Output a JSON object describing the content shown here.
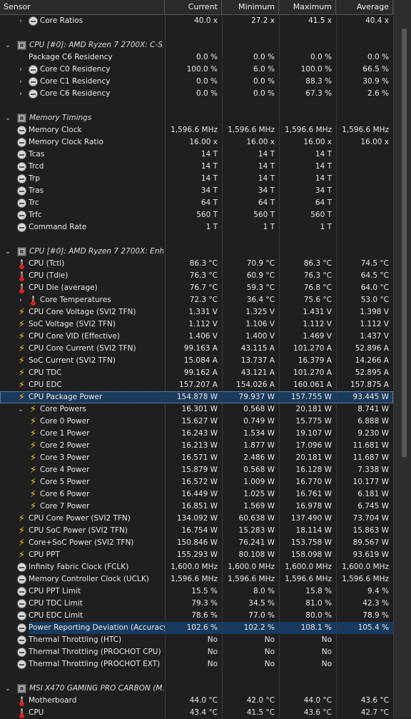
{
  "header": {
    "sensor": "Sensor",
    "current": "Current",
    "minimum": "Minimum",
    "maximum": "Maximum",
    "average": "Average"
  },
  "rows": [
    {
      "type": "sensor",
      "indent": 1,
      "chev": "›",
      "icon": "clock",
      "label": "Core Ratios",
      "cur": "40.0 x",
      "min": "27.2 x",
      "max": "41.5 x",
      "avg": "40.4 x"
    },
    {
      "type": "blank"
    },
    {
      "type": "group",
      "label": "CPU [#0]: AMD Ryzen 7 2700X: C-S..."
    },
    {
      "type": "sensor",
      "indent": 0,
      "icon": "none",
      "label": "Package C6 Residency",
      "cur": "0.0 %",
      "min": "0.0 %",
      "max": "0.0 %",
      "avg": "0.0 %"
    },
    {
      "type": "sensor",
      "indent": 1,
      "chev": "›",
      "icon": "clock",
      "label": "Core C0 Residency",
      "cur": "100.0 %",
      "min": "6.0 %",
      "max": "100.0 %",
      "avg": "66.5 %"
    },
    {
      "type": "sensor",
      "indent": 1,
      "chev": "›",
      "icon": "clock",
      "label": "Core C1 Residency",
      "cur": "0.0 %",
      "min": "0.0 %",
      "max": "88.3 %",
      "avg": "30.9 %"
    },
    {
      "type": "sensor",
      "indent": 1,
      "chev": "›",
      "icon": "clock",
      "label": "Core C6 Residency",
      "cur": "0.0 %",
      "min": "0.0 %",
      "max": "67.3 %",
      "avg": "2.6 %"
    },
    {
      "type": "blank"
    },
    {
      "type": "group",
      "label": "Memory Timings"
    },
    {
      "type": "sensor",
      "indent": 0,
      "icon": "clock",
      "label": "Memory Clock",
      "cur": "1,596.6 MHz",
      "min": "1,596.6 MHz",
      "max": "1,596.6 MHz",
      "avg": "1,596.6 MHz"
    },
    {
      "type": "sensor",
      "indent": 0,
      "icon": "clock",
      "label": "Memory Clock Ratio",
      "cur": "16.00 x",
      "min": "16.00 x",
      "max": "16.00 x",
      "avg": "16.00 x"
    },
    {
      "type": "sensor",
      "indent": 0,
      "icon": "clock",
      "label": "Tcas",
      "cur": "14 T",
      "min": "14 T",
      "max": "14 T",
      "avg": ""
    },
    {
      "type": "sensor",
      "indent": 0,
      "icon": "clock",
      "label": "Trcd",
      "cur": "14 T",
      "min": "14 T",
      "max": "14 T",
      "avg": ""
    },
    {
      "type": "sensor",
      "indent": 0,
      "icon": "clock",
      "label": "Trp",
      "cur": "14 T",
      "min": "14 T",
      "max": "14 T",
      "avg": ""
    },
    {
      "type": "sensor",
      "indent": 0,
      "icon": "clock",
      "label": "Tras",
      "cur": "34 T",
      "min": "34 T",
      "max": "34 T",
      "avg": ""
    },
    {
      "type": "sensor",
      "indent": 0,
      "icon": "clock",
      "label": "Trc",
      "cur": "64 T",
      "min": "64 T",
      "max": "64 T",
      "avg": ""
    },
    {
      "type": "sensor",
      "indent": 0,
      "icon": "clock",
      "label": "Trfc",
      "cur": "560 T",
      "min": "560 T",
      "max": "560 T",
      "avg": ""
    },
    {
      "type": "sensor",
      "indent": 0,
      "icon": "clock",
      "label": "Command Rate",
      "cur": "1 T",
      "min": "1 T",
      "max": "1 T",
      "avg": ""
    },
    {
      "type": "blank"
    },
    {
      "type": "group",
      "label": "CPU [#0]: AMD Ryzen 7 2700X: Enh..."
    },
    {
      "type": "sensor",
      "indent": 0,
      "icon": "therm",
      "label": "CPU (Tctl)",
      "cur": "86.3 °C",
      "min": "70.9 °C",
      "max": "86.3 °C",
      "avg": "74.5 °C"
    },
    {
      "type": "sensor",
      "indent": 0,
      "icon": "therm",
      "label": "CPU (Tdie)",
      "cur": "76.3 °C",
      "min": "60.9 °C",
      "max": "76.3 °C",
      "avg": "64.5 °C"
    },
    {
      "type": "sensor",
      "indent": 0,
      "icon": "therm",
      "label": "CPU Die (average)",
      "cur": "76.7 °C",
      "min": "59.3 °C",
      "max": "76.8 °C",
      "avg": "64.0 °C"
    },
    {
      "type": "sensor",
      "indent": 1,
      "chev": "›",
      "icon": "therm",
      "label": "Core Temperatures",
      "cur": "72.3 °C",
      "min": "36.4 °C",
      "max": "75.6 °C",
      "avg": "53.0 °C"
    },
    {
      "type": "sensor",
      "indent": 0,
      "icon": "bolt",
      "label": "CPU Core Voltage (SVI2 TFN)",
      "cur": "1.331 V",
      "min": "1.325 V",
      "max": "1.431 V",
      "avg": "1.398 V"
    },
    {
      "type": "sensor",
      "indent": 0,
      "icon": "bolt",
      "label": "SoC Voltage (SVI2 TFN)",
      "cur": "1.112 V",
      "min": "1.106 V",
      "max": "1.112 V",
      "avg": "1.112 V"
    },
    {
      "type": "sensor",
      "indent": 0,
      "icon": "bolt",
      "label": "CPU Core VID (Effective)",
      "cur": "1.406 V",
      "min": "1.400 V",
      "max": "1.469 V",
      "avg": "1.437 V"
    },
    {
      "type": "sensor",
      "indent": 0,
      "icon": "bolt",
      "label": "CPU Core Current (SVI2 TFN)",
      "cur": "99.163 A",
      "min": "43.115 A",
      "max": "101.270 A",
      "avg": "52.896 A"
    },
    {
      "type": "sensor",
      "indent": 0,
      "icon": "bolt",
      "label": "SoC Current (SVI2 TFN)",
      "cur": "15.084 A",
      "min": "13.737 A",
      "max": "16.379 A",
      "avg": "14.266 A"
    },
    {
      "type": "sensor",
      "indent": 0,
      "icon": "bolt",
      "label": "CPU TDC",
      "cur": "99.162 A",
      "min": "43.121 A",
      "max": "101.270 A",
      "avg": "52.895 A"
    },
    {
      "type": "sensor",
      "indent": 0,
      "icon": "bolt",
      "label": "CPU EDC",
      "cur": "157.207 A",
      "min": "154.026 A",
      "max": "160.061 A",
      "avg": "157.875 A"
    },
    {
      "type": "sensor",
      "indent": 0,
      "icon": "bolt",
      "label": "CPU Package Power",
      "cur": "154.878 W",
      "min": "79.937 W",
      "max": "157.755 W",
      "avg": "93.445 W",
      "selected": true
    },
    {
      "type": "sensor",
      "indent": 1,
      "chev": "⌄",
      "icon": "bolt",
      "label": "Core Powers",
      "cur": "16.301 W",
      "min": "0.568 W",
      "max": "20.181 W",
      "avg": "8.741 W"
    },
    {
      "type": "sensor",
      "indent": 1,
      "icon": "bolt",
      "label": "Core 0 Power",
      "cur": "15.627 W",
      "min": "0.749 W",
      "max": "15.775 W",
      "avg": "6.888 W"
    },
    {
      "type": "sensor",
      "indent": 1,
      "icon": "bolt",
      "label": "Core 1 Power",
      "cur": "16.243 W",
      "min": "1.534 W",
      "max": "19.107 W",
      "avg": "9.230 W"
    },
    {
      "type": "sensor",
      "indent": 1,
      "icon": "bolt",
      "label": "Core 2 Power",
      "cur": "16.213 W",
      "min": "1.877 W",
      "max": "17.096 W",
      "avg": "11.681 W"
    },
    {
      "type": "sensor",
      "indent": 1,
      "icon": "bolt",
      "label": "Core 3 Power",
      "cur": "16.571 W",
      "min": "2.486 W",
      "max": "20.181 W",
      "avg": "11.687 W"
    },
    {
      "type": "sensor",
      "indent": 1,
      "icon": "bolt",
      "label": "Core 4 Power",
      "cur": "15.879 W",
      "min": "0.568 W",
      "max": "16.128 W",
      "avg": "7.338 W"
    },
    {
      "type": "sensor",
      "indent": 1,
      "icon": "bolt",
      "label": "Core 5 Power",
      "cur": "16.572 W",
      "min": "1.009 W",
      "max": "16.770 W",
      "avg": "10.177 W"
    },
    {
      "type": "sensor",
      "indent": 1,
      "icon": "bolt",
      "label": "Core 6 Power",
      "cur": "16.449 W",
      "min": "1.025 W",
      "max": "16.761 W",
      "avg": "6.181 W"
    },
    {
      "type": "sensor",
      "indent": 1,
      "icon": "bolt",
      "label": "Core 7 Power",
      "cur": "16.851 W",
      "min": "1.569 W",
      "max": "16.978 W",
      "avg": "6.745 W"
    },
    {
      "type": "sensor",
      "indent": 0,
      "icon": "bolt",
      "label": "CPU Core Power (SVI2 TFN)",
      "cur": "134.092 W",
      "min": "60.638 W",
      "max": "137.490 W",
      "avg": "73.704 W"
    },
    {
      "type": "sensor",
      "indent": 0,
      "icon": "bolt",
      "label": "CPU SoC Power (SVI2 TFN)",
      "cur": "16.754 W",
      "min": "15.283 W",
      "max": "18.114 W",
      "avg": "15.863 W"
    },
    {
      "type": "sensor",
      "indent": 0,
      "icon": "bolt",
      "label": "Core+SoC Power (SVI2 TFN)",
      "cur": "150.846 W",
      "min": "76.241 W",
      "max": "153.758 W",
      "avg": "89.567 W"
    },
    {
      "type": "sensor",
      "indent": 0,
      "icon": "bolt",
      "label": "CPU PPT",
      "cur": "155.293 W",
      "min": "80.108 W",
      "max": "158.098 W",
      "avg": "93.619 W"
    },
    {
      "type": "sensor",
      "indent": 0,
      "icon": "clock",
      "label": "Infinity Fabric Clock (FCLK)",
      "cur": "1,600.0 MHz",
      "min": "1,600.0 MHz",
      "max": "1,600.0 MHz",
      "avg": "1,600.0 MHz"
    },
    {
      "type": "sensor",
      "indent": 0,
      "icon": "clock",
      "label": "Memory Controller Clock (UCLK)",
      "cur": "1,596.6 MHz",
      "min": "1,596.6 MHz",
      "max": "1,596.6 MHz",
      "avg": "1,596.6 MHz"
    },
    {
      "type": "sensor",
      "indent": 0,
      "icon": "clock",
      "label": "CPU PPT Limit",
      "cur": "15.5 %",
      "min": "8.0 %",
      "max": "15.8 %",
      "avg": "9.4 %"
    },
    {
      "type": "sensor",
      "indent": 0,
      "icon": "clock",
      "label": "CPU TDC Limit",
      "cur": "79.3 %",
      "min": "34.5 %",
      "max": "81.0 %",
      "avg": "42.3 %"
    },
    {
      "type": "sensor",
      "indent": 0,
      "icon": "clock",
      "label": "CPU EDC Limit",
      "cur": "78.6 %",
      "min": "77.0 %",
      "max": "80.0 %",
      "avg": "78.9 %"
    },
    {
      "type": "sensor",
      "indent": 0,
      "icon": "clock",
      "label": "Power Reporting Deviation (Accuracy)",
      "cur": "102.6 %",
      "min": "102.2 %",
      "max": "108.1 %",
      "avg": "105.4 %",
      "highlight": true
    },
    {
      "type": "sensor",
      "indent": 0,
      "icon": "clock",
      "label": "Thermal Throttling (HTC)",
      "cur": "No",
      "min": "No",
      "max": "No",
      "avg": ""
    },
    {
      "type": "sensor",
      "indent": 0,
      "icon": "clock",
      "label": "Thermal Throttling (PROCHOT CPU)",
      "cur": "No",
      "min": "No",
      "max": "No",
      "avg": ""
    },
    {
      "type": "sensor",
      "indent": 0,
      "icon": "clock",
      "label": "Thermal Throttling (PROCHOT EXT)",
      "cur": "No",
      "min": "No",
      "max": "No",
      "avg": ""
    },
    {
      "type": "blank"
    },
    {
      "type": "group",
      "label": "MSI X470 GAMING PRO CARBON (M..."
    },
    {
      "type": "sensor",
      "indent": 0,
      "icon": "therm",
      "label": "Motherboard",
      "cur": "44.0 °C",
      "min": "42.0 °C",
      "max": "44.0 °C",
      "avg": "43.6 °C"
    },
    {
      "type": "sensor",
      "indent": 0,
      "icon": "therm",
      "label": "CPU",
      "cur": "43.4 °C",
      "min": "41.5 °C",
      "max": "43.6 °C",
      "avg": "42.7 °C"
    }
  ]
}
